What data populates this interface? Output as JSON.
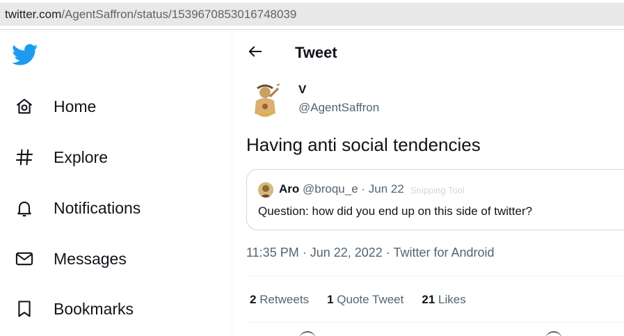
{
  "browser": {
    "url_host": "twitter.com",
    "url_path": "/AgentSaffron/status/1539670853016748039"
  },
  "sidebar": {
    "logo_icon": "twitter-bird-icon",
    "items": [
      {
        "label": "Home",
        "icon": "home-icon"
      },
      {
        "label": "Explore",
        "icon": "hashtag-icon"
      },
      {
        "label": "Notifications",
        "icon": "bell-icon"
      },
      {
        "label": "Messages",
        "icon": "envelope-icon"
      },
      {
        "label": "Bookmarks",
        "icon": "bookmark-icon"
      }
    ]
  },
  "header": {
    "title": "Tweet",
    "back_icon": "back-arrow-icon"
  },
  "tweet": {
    "author_name": "V",
    "author_handle": "@AgentSaffron",
    "text": "Having anti social tendencies",
    "timestamp": "11:35 PM · Jun 22, 2022 · Twitter for Android"
  },
  "quote": {
    "name": "Aro",
    "meta": "@broqu_e · Jun 22",
    "text": "Question: how did you end up on this side of twitter?",
    "ghost_text": "Snipping Tool"
  },
  "stats": {
    "retweets_count": "2",
    "retweets_label": "Retweets",
    "quotes_count": "1",
    "quotes_label": "Quote Tweet",
    "likes_count": "21",
    "likes_label": "Likes"
  },
  "colors": {
    "brand": "#1d9bf0",
    "text_primary": "#0f1419",
    "text_secondary": "#536471"
  }
}
